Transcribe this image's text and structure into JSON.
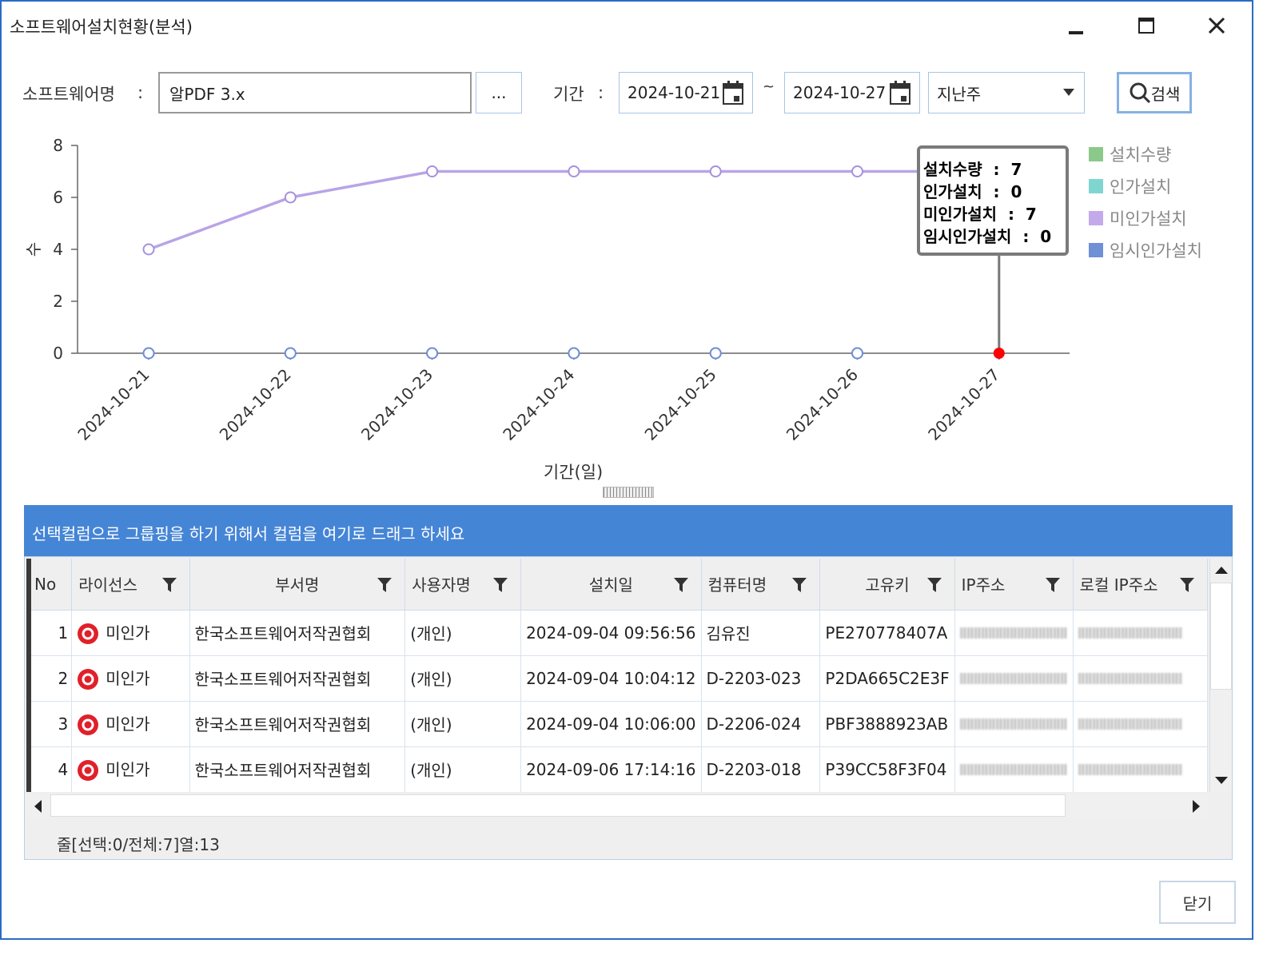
{
  "window": {
    "title": "소프트웨어설치현황(분석)"
  },
  "filter": {
    "software_label": "소프트웨어명",
    "colon": ":",
    "software_value": "알PDF 3.x",
    "browse_label": "...",
    "period_label": "기간",
    "start_date": "2024-10-21",
    "tilde": "~",
    "end_date": "2024-10-27",
    "range_select": "지난주",
    "search_label": "검색"
  },
  "chart_data": {
    "type": "line",
    "categories": [
      "2024-10-21",
      "2024-10-22",
      "2024-10-23",
      "2024-10-24",
      "2024-10-25",
      "2024-10-26",
      "2024-10-27"
    ],
    "series": [
      {
        "name": "설치수량",
        "values": [
          4,
          6,
          7,
          7,
          7,
          7,
          7
        ],
        "color": "#8bc98b"
      },
      {
        "name": "인가설치",
        "values": [
          0,
          0,
          0,
          0,
          0,
          0,
          0
        ],
        "color": "#7fd6d0"
      },
      {
        "name": "미인가설치",
        "values": [
          4,
          6,
          7,
          7,
          7,
          7,
          7
        ],
        "color": "#c4aaea"
      },
      {
        "name": "임시인가설치",
        "values": [
          0,
          0,
          0,
          0,
          0,
          0,
          0
        ],
        "color": "#6f8fd6"
      }
    ],
    "xlabel": "기간(일)",
    "ylabel": "수",
    "ylim": [
      0,
      8
    ],
    "yticks": [
      "0",
      "2",
      "4",
      "6",
      "8"
    ],
    "legend": "right",
    "tooltip": {
      "rows": [
        {
          "label": "설치수량",
          "sep": ":",
          "value": "7"
        },
        {
          "label": "인가설치",
          "sep": ":",
          "value": "0"
        },
        {
          "label": "미인가설치",
          "sep": ":",
          "value": "7"
        },
        {
          "label": "임시인가설치",
          "sep": ":",
          "value": "0"
        }
      ]
    }
  },
  "grid": {
    "group_hint": "선택컬럼으로 그룹핑을 하기 위해서 컬럼을 여기로 드래그 하세요",
    "columns": [
      "No",
      "라이선스",
      "부서명",
      "사용자명",
      "설치일",
      "컴퓨터명",
      "고유키",
      "IP주소",
      "로컬 IP주소"
    ],
    "rows": [
      {
        "no": "1",
        "license": "미인가",
        "dept": "한국소프트웨어저작권협회",
        "user": "(개인)",
        "installed": "2024-09-04 09:56:56",
        "computer": "김유진",
        "key": "PE270778407A"
      },
      {
        "no": "2",
        "license": "미인가",
        "dept": "한국소프트웨어저작권협회",
        "user": "(개인)",
        "installed": "2024-09-04 10:04:12",
        "computer": "D-2203-023",
        "key": "P2DA665C2E3F"
      },
      {
        "no": "3",
        "license": "미인가",
        "dept": "한국소프트웨어저작권협회",
        "user": "(개인)",
        "installed": "2024-09-04 10:06:00",
        "computer": "D-2206-024",
        "key": "PBF3888923AB"
      },
      {
        "no": "4",
        "license": "미인가",
        "dept": "한국소프트웨어저작권협회",
        "user": "(개인)",
        "installed": "2024-09-06 17:14:16",
        "computer": "D-2203-018",
        "key": "P39CC58F3F04"
      }
    ],
    "status": "줄[선택:0/전체:7]열:13"
  },
  "footer": {
    "close_label": "닫기"
  },
  "colors": {
    "accent": "#4585d6",
    "unauthorized": "#e0202a",
    "highlight_point": "#ff0000"
  },
  "icons": [
    "minimize-icon",
    "maximize-icon",
    "close-icon",
    "calendar-icon",
    "dropdown-arrow-icon",
    "search-icon",
    "filter-icon",
    "unauthorized-icon",
    "scroll-up-icon",
    "scroll-down-icon",
    "scroll-left-icon",
    "scroll-right-icon"
  ]
}
